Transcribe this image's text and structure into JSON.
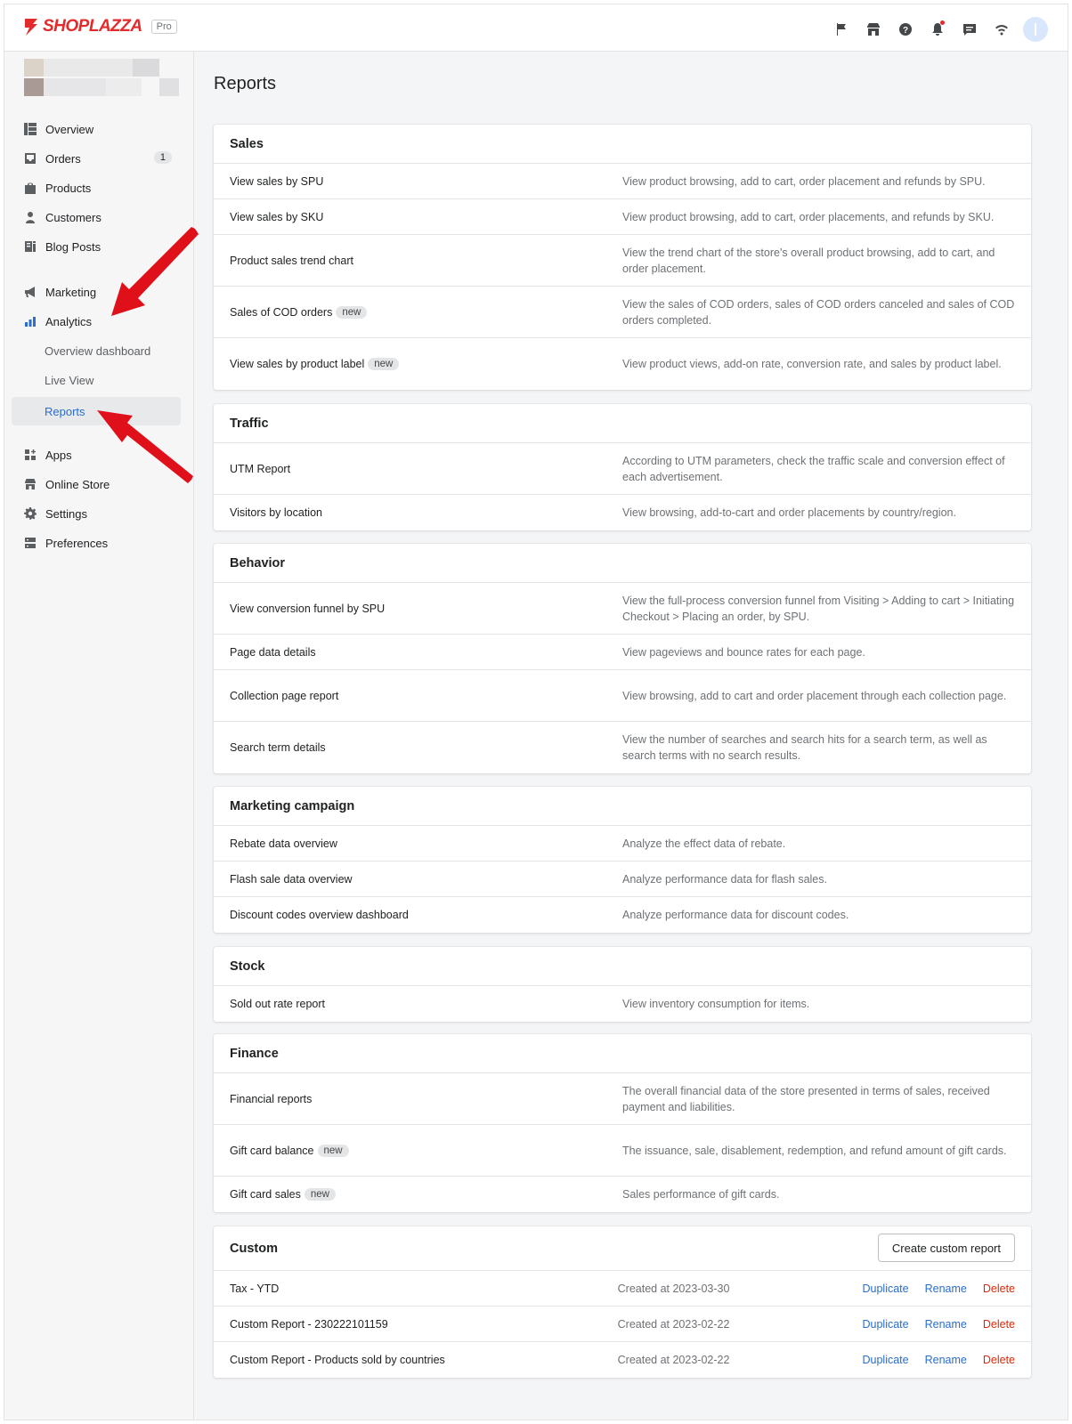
{
  "brand": {
    "name": "SHOPLAZZA",
    "plan_badge": "Pro",
    "accent": "#e32b2b"
  },
  "topbar_icons": [
    "flag-icon",
    "store-icon",
    "help-icon",
    "bell-icon",
    "chat-icon",
    "wifi-icon"
  ],
  "sidebar": {
    "items": [
      {
        "label": "Overview",
        "icon": "overview-icon"
      },
      {
        "label": "Orders",
        "icon": "orders-icon",
        "badge": "1"
      },
      {
        "label": "Products",
        "icon": "products-icon"
      },
      {
        "label": "Customers",
        "icon": "customers-icon"
      },
      {
        "label": "Blog Posts",
        "icon": "blog-icon"
      },
      {
        "label": "Marketing",
        "icon": "marketing-icon"
      },
      {
        "label": "Analytics",
        "icon": "analytics-icon"
      },
      {
        "label": "Apps",
        "icon": "apps-icon"
      },
      {
        "label": "Online Store",
        "icon": "online-store-icon"
      },
      {
        "label": "Settings",
        "icon": "settings-icon"
      },
      {
        "label": "Preferences",
        "icon": "preferences-icon"
      }
    ],
    "analytics_sub": [
      {
        "label": "Overview dashboard"
      },
      {
        "label": "Live View"
      },
      {
        "label": "Reports",
        "active": true
      }
    ]
  },
  "page": {
    "title": "Reports"
  },
  "new_tag": "new",
  "sections": [
    {
      "title": "Sales",
      "rows": [
        {
          "name": "View sales by SPU",
          "desc": "View product browsing, add to cart, order placement and refunds by SPU."
        },
        {
          "name": "View sales by SKU",
          "desc": "View product browsing, add to cart, order placements, and refunds by SKU."
        },
        {
          "name": "Product sales trend chart",
          "desc": "View the trend chart of the store's overall product browsing, add to cart, and order placement."
        },
        {
          "name": "Sales of COD orders",
          "is_new": true,
          "desc": "View the sales of COD orders, sales of COD orders canceled and sales of COD orders completed."
        },
        {
          "name": "View sales by product label",
          "is_new": true,
          "desc": "View product views, add-on rate, conversion rate, and sales by product label."
        }
      ]
    },
    {
      "title": "Traffic",
      "rows": [
        {
          "name": "UTM Report",
          "desc": "According to UTM parameters, check the traffic scale and conversion effect of each advertisement."
        },
        {
          "name": "Visitors by location",
          "desc": "View browsing, add-to-cart and order placements by country/region."
        }
      ]
    },
    {
      "title": "Behavior",
      "rows": [
        {
          "name": "View conversion funnel by SPU",
          "desc": "View the full-process conversion funnel from Visiting > Adding to cart > Initiating Checkout > Placing an order, by SPU."
        },
        {
          "name": "Page data details",
          "desc": "View pageviews and bounce rates for each page."
        },
        {
          "name": "Collection page report",
          "desc": "View browsing, add to cart and order placement through each collection page."
        },
        {
          "name": "Search term details",
          "desc": "View the number of searches and search hits for a search term, as well as search terms with no search results."
        }
      ]
    },
    {
      "title": "Marketing campaign",
      "rows": [
        {
          "name": "Rebate data overview",
          "desc": "Analyze the effect data of rebate."
        },
        {
          "name": "Flash sale data overview",
          "desc": "Analyze performance data for flash sales."
        },
        {
          "name": "Discount codes overview dashboard",
          "desc": "Analyze performance data for discount codes."
        }
      ]
    },
    {
      "title": "Stock",
      "rows": [
        {
          "name": "Sold out rate report",
          "desc": "View inventory consumption for items."
        }
      ]
    },
    {
      "title": "Finance",
      "rows": [
        {
          "name": "Financial reports",
          "desc": "The overall financial data of the store presented in terms of sales, received payment and liabilities."
        },
        {
          "name": "Gift card balance",
          "is_new": true,
          "desc": "The issuance, sale, disablement, redemption, and refund amount of gift cards."
        },
        {
          "name": "Gift card sales",
          "is_new": true,
          "desc": "Sales performance of gift cards."
        }
      ]
    }
  ],
  "custom": {
    "title": "Custom",
    "create_label": "Create custom report",
    "actions": {
      "duplicate": "Duplicate",
      "rename": "Rename",
      "delete": "Delete"
    },
    "rows": [
      {
        "name": "Tax - YTD",
        "created": "Created at 2023-03-30"
      },
      {
        "name": "Custom Report - 230222101159",
        "created": "Created at 2023-02-22"
      },
      {
        "name": "Custom Report - Products sold by countries",
        "created": "Created at 2023-02-22"
      }
    ]
  },
  "colors": {
    "link": "#2c6ecb",
    "danger": "#d82c0d",
    "annotation_arrow": "#e0101a"
  }
}
